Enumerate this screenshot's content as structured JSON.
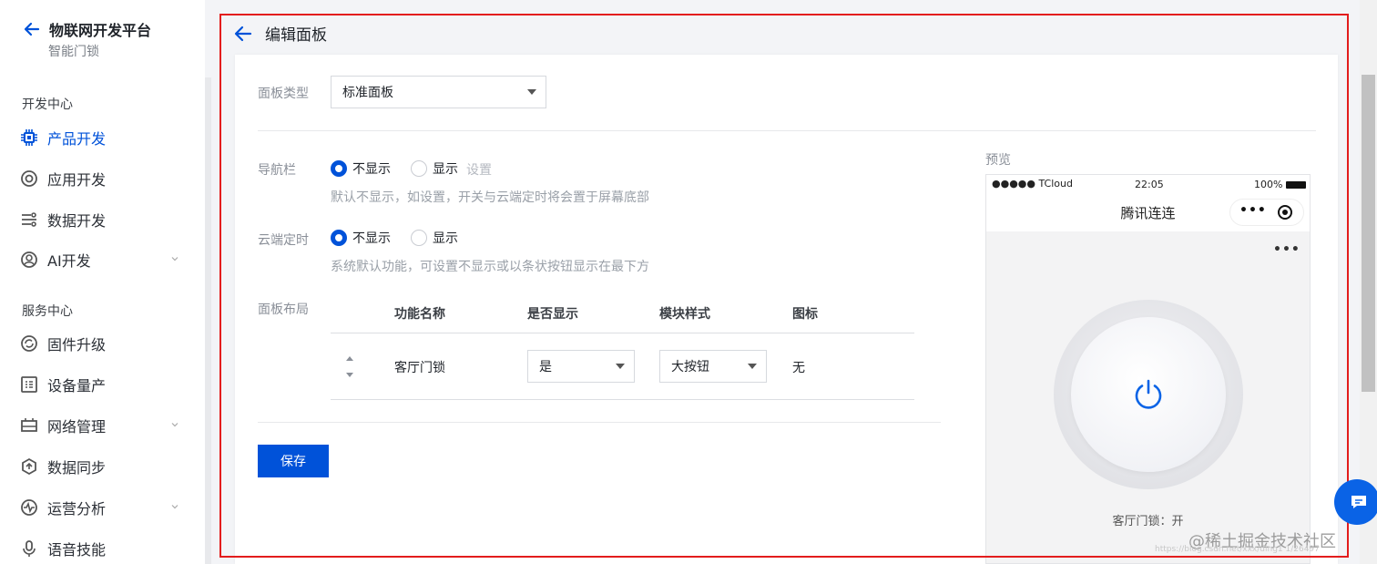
{
  "sidebar": {
    "brand_title": "物联网开发平台",
    "brand_sub": "智能门锁",
    "sections": [
      {
        "title": "开发中心",
        "items": [
          {
            "label": "产品开发",
            "icon": "chip-icon",
            "active": true
          },
          {
            "label": "应用开发",
            "icon": "app-icon"
          },
          {
            "label": "数据开发",
            "icon": "data-flow-icon"
          },
          {
            "label": "AI开发",
            "icon": "ai-icon",
            "expandable": true
          }
        ]
      },
      {
        "title": "服务中心",
        "items": [
          {
            "label": "固件升级",
            "icon": "firmware-icon"
          },
          {
            "label": "设备量产",
            "icon": "device-batch-icon"
          },
          {
            "label": "网络管理",
            "icon": "network-icon",
            "expandable": true
          },
          {
            "label": "数据同步",
            "icon": "sync-icon"
          },
          {
            "label": "运营分析",
            "icon": "analytics-icon",
            "expandable": true
          },
          {
            "label": "语音技能",
            "icon": "voice-icon"
          }
        ]
      }
    ]
  },
  "page": {
    "title": "编辑面板"
  },
  "form": {
    "panel_type_label": "面板类型",
    "panel_type_value": "标准面板",
    "navbar_label": "导航栏",
    "navbar_options": [
      "不显示",
      "显示"
    ],
    "navbar_selected": "不显示",
    "navbar_settings": "设置",
    "navbar_hint": "默认不显示，如设置，开关与云端定时将会置于屏幕底部",
    "timer_label": "云端定时",
    "timer_options": [
      "不显示",
      "显示"
    ],
    "timer_selected": "不显示",
    "timer_hint": "系统默认功能，可设置不显示或以条状按钮显示在最下方",
    "layout_label": "面板布局",
    "table": {
      "headers": [
        "功能名称",
        "是否显示",
        "模块样式",
        "图标"
      ],
      "rows": [
        {
          "name": "客厅门锁",
          "visible": "是",
          "style": "大按钮",
          "icon": "无"
        }
      ]
    },
    "save_label": "保存"
  },
  "preview": {
    "label": "预览",
    "status_carrier": "●●●●● TCloud",
    "status_time": "22:05",
    "status_battery": "100%",
    "app_title": "腾讯连连",
    "capsule_more": "•••",
    "page_dots": "•••",
    "power_caption": "客厅门锁：开"
  },
  "watermark": {
    "text": "@稀土掘金技术社区",
    "url": "https://blog.csdn.net/xxx/ding1 1/26497"
  },
  "colors": {
    "primary": "#0052d9",
    "highlight_frame": "#e31d1d"
  }
}
